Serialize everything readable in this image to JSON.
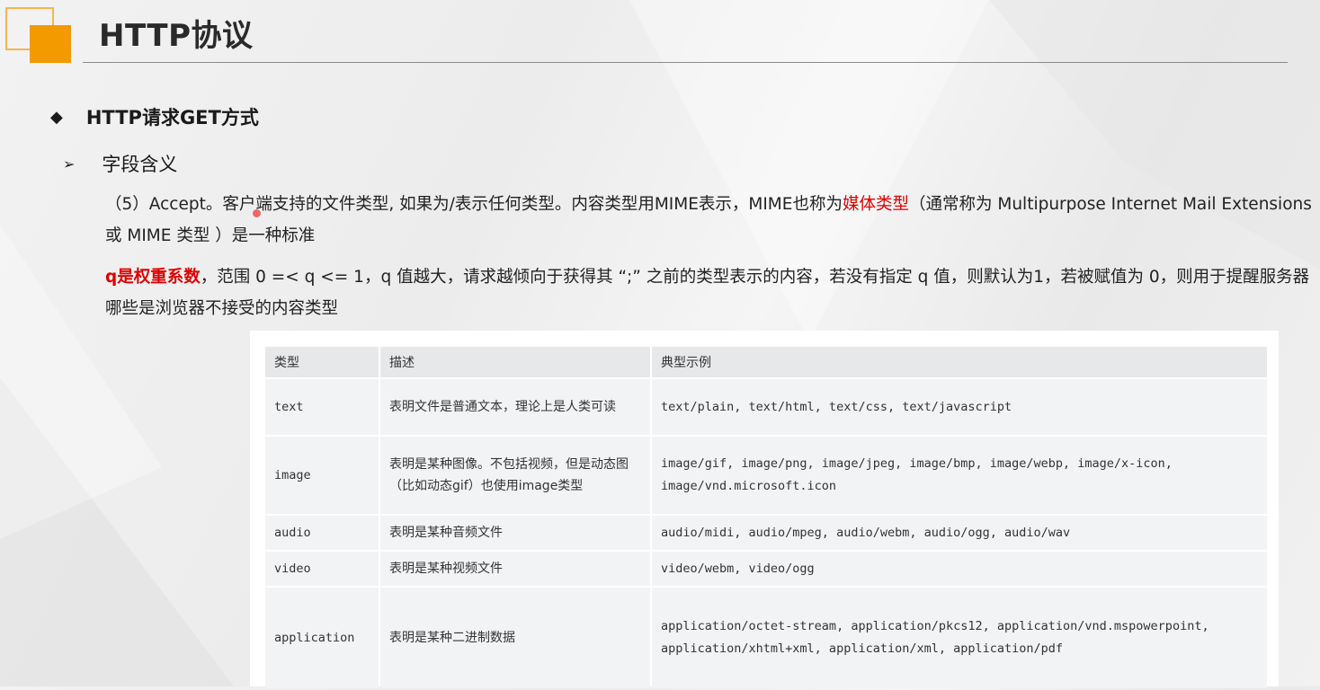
{
  "header": {
    "title": "HTTP协议"
  },
  "section": {
    "heading": "HTTP请求GET方式",
    "subheading": "字段含义"
  },
  "para1": {
    "part1": "（5）Accept。客户端支持的文件类型, 如果为/表示任何类型。内容类型用MIME表示，MIME也称为",
    "highlight": "媒体类型",
    "part2": "（通常称为 Multipurpose Internet Mail Extensions 或 MIME 类型 ）是一种标准"
  },
  "para2": {
    "highlight": "q是权重系数",
    "part1": "，范围 0 =< q <= 1，q 值越大，请求越倾向于获得其 “;” 之前的类型表示的内容，若没有指定 q 值，则默认为1，若被赋值为 0，则用于提醒服务器哪些是浏览器不接受的内容类型"
  },
  "table": {
    "headers": [
      "类型",
      "描述",
      "典型示例"
    ],
    "rows": [
      {
        "type": "text",
        "desc": "表明文件是普通文本，理论上是人类可读",
        "examples": "text/plain, text/html, text/css, text/javascript"
      },
      {
        "type": "image",
        "desc": "表明是某种图像。不包括视频，但是动态图（比如动态gif）也使用image类型",
        "examples": "image/gif, image/png, image/jpeg, image/bmp, image/webp, image/x-icon, image/vnd.microsoft.icon"
      },
      {
        "type": "audio",
        "desc": "表明是某种音频文件",
        "examples": "audio/midi, audio/mpeg, audio/webm, audio/ogg, audio/wav"
      },
      {
        "type": "video",
        "desc": "表明是某种视频文件",
        "examples": "video/webm, video/ogg"
      },
      {
        "type": "application",
        "desc": "表明是某种二进制数据",
        "examples": "application/octet-stream, application/pkcs12, application/vnd.mspowerpoint, application/xhtml+xml, application/xml, application/pdf"
      }
    ]
  },
  "icons": {
    "diamond_bullet": "◆",
    "arrow_bullet": "➢"
  },
  "colors": {
    "accent_orange": "#f39a00",
    "highlight_red": "#e00000"
  }
}
